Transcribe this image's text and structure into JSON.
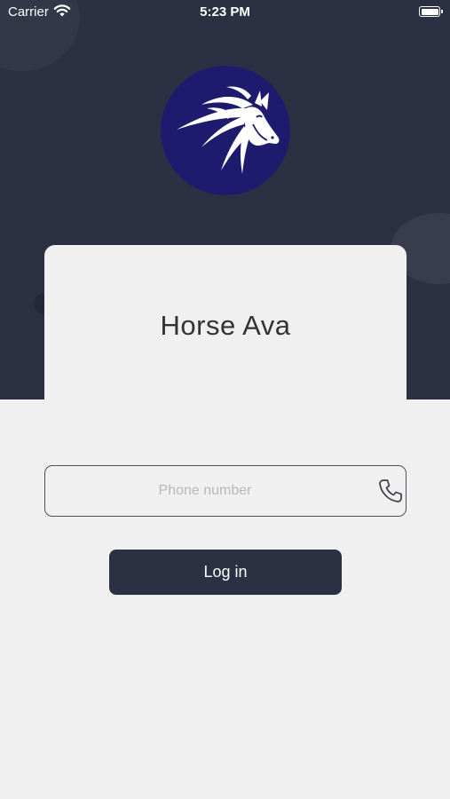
{
  "status_bar": {
    "carrier": "Carrier",
    "time": "5:23 PM",
    "wifi_icon": "wifi-icon",
    "battery_icon": "battery-icon"
  },
  "logo": {
    "icon": "horse-head-icon",
    "background_color": "#1e1b6e"
  },
  "app": {
    "title": "Horse Ava"
  },
  "phone_field": {
    "value": "",
    "placeholder": "Phone number",
    "icon": "phone-icon"
  },
  "login": {
    "label": "Log in"
  },
  "colors": {
    "header_background": "#2b3142",
    "page_background": "#f0f0f0",
    "button_background": "#2b3142"
  }
}
